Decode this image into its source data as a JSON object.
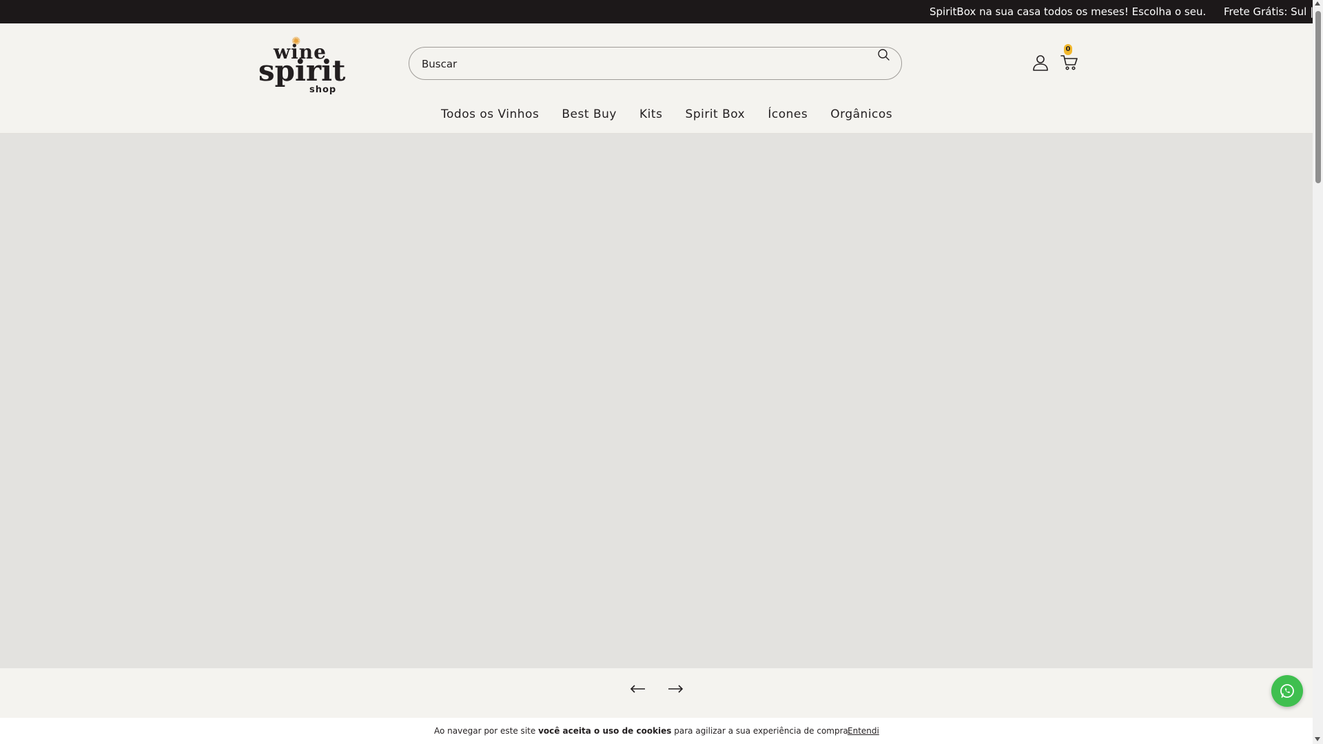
{
  "announcement": {
    "messages": [
      "SpiritBox na sua casa todos os meses! Escolha o seu.",
      "Frete Grátis: Sul |"
    ]
  },
  "header": {
    "logo": {
      "line1": "wine",
      "line2": "spirit",
      "line3": "shop"
    },
    "search": {
      "placeholder": "Buscar"
    },
    "cart": {
      "count": "0"
    },
    "colors": {
      "badge": "#f1b82d",
      "topbar": "#1c1819"
    }
  },
  "nav": {
    "items": [
      {
        "label": "Todos os Vinhos"
      },
      {
        "label": "Best Buy"
      },
      {
        "label": "Kits"
      },
      {
        "label": "Spirit Box"
      },
      {
        "label": "Ícones"
      },
      {
        "label": "Orgânicos"
      }
    ]
  },
  "slider": {
    "prev_icon": "arrow-left-icon",
    "next_icon": "arrow-right-icon"
  },
  "cookie": {
    "text_before": "Ao navegar por este site ",
    "text_bold": "você aceita o uso de cookies",
    "text_after": " para agilizar a sua experiência de compra.",
    "accept_label": "Entendi"
  },
  "whatsapp": {
    "icon": "whatsapp-icon",
    "color": "#3fbf4f"
  }
}
